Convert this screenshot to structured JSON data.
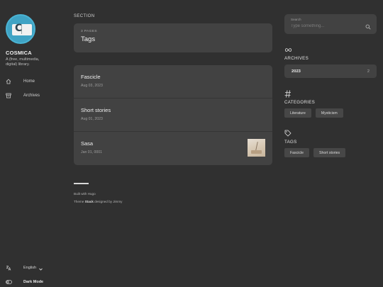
{
  "site": {
    "name": "COSMICA",
    "description": "A (free, multimedia, digital) library."
  },
  "menu": [
    {
      "label": "Home",
      "icon": "home-icon"
    },
    {
      "label": "Archives",
      "icon": "archive-box-icon"
    }
  ],
  "sidebar_bottom": {
    "language": "English",
    "dark_mode_label": "Dark Mode"
  },
  "main": {
    "section_label": "SECTION",
    "header": {
      "count": "3 PAGES",
      "title": "Tags"
    },
    "articles": [
      {
        "title": "Fascicle",
        "date": "Aug 03, 2023",
        "has_thumbnail": false
      },
      {
        "title": "Short stories",
        "date": "Aug 01, 2023",
        "has_thumbnail": false
      },
      {
        "title": "Sasa",
        "date": "Jan 01, 0001",
        "has_thumbnail": true
      }
    ],
    "footer": {
      "built_with": "Built with Hugo",
      "theme_prefix": "Theme",
      "theme_name": "Stack",
      "theme_suffix": "designed by Jimmy"
    }
  },
  "search": {
    "label": "Search",
    "placeholder": "Type something..."
  },
  "widgets": {
    "archives": {
      "title": "ARCHIVES",
      "year": "2023",
      "count": "2"
    },
    "categories": {
      "title": "CATEGORIES",
      "items": [
        "Literature",
        "Mysticism"
      ]
    },
    "tags": {
      "title": "TAGS",
      "items": [
        "Fascicle",
        "Short stories"
      ]
    }
  },
  "colors": {
    "background": "#303030",
    "card": "#424242",
    "text": "#f0f0f0",
    "muted": "#9e9e9e"
  }
}
